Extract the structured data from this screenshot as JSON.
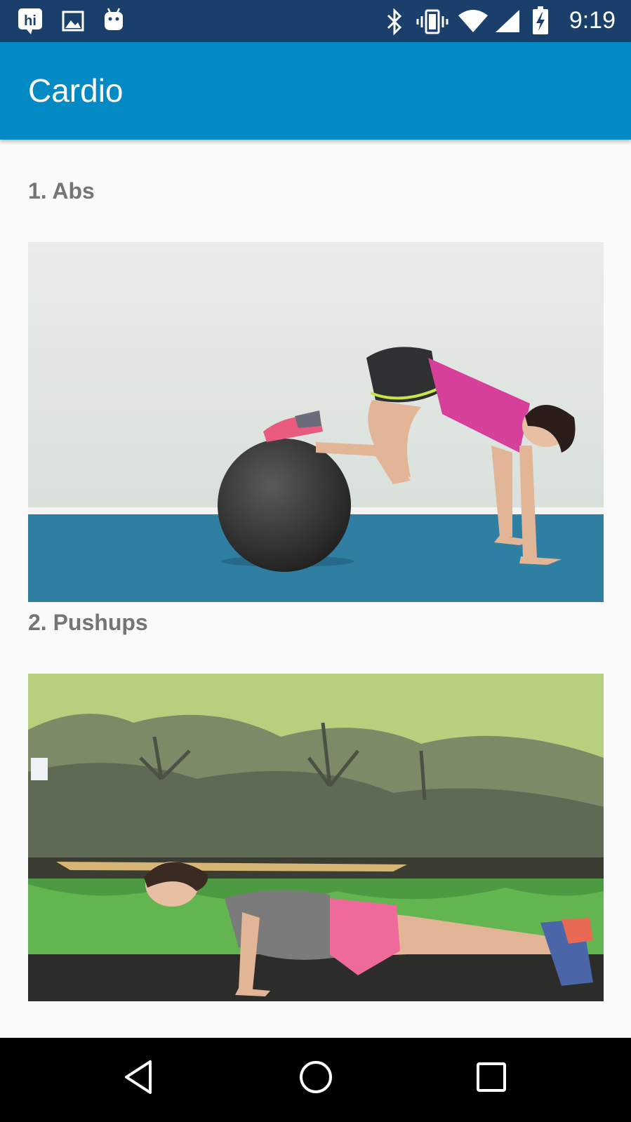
{
  "status_bar": {
    "time": "9:19",
    "left_icons": [
      "hi-app-icon",
      "image-icon",
      "android-icon"
    ],
    "right_icons": [
      "bluetooth-icon",
      "vibrate-icon",
      "wifi-icon",
      "signal-icon",
      "battery-charging-icon"
    ]
  },
  "app_bar": {
    "title": "Cardio"
  },
  "exercises": [
    {
      "title": "1. Abs",
      "image_alt": "stability-ball-knee-tuck"
    },
    {
      "title": "2. Pushups",
      "image_alt": "pushup"
    }
  ],
  "nav_bar": {
    "buttons": [
      "back-icon",
      "home-icon",
      "recents-icon"
    ]
  },
  "colors": {
    "status_bar": "#1a3f6b",
    "app_bar": "#0389c4",
    "background": "#fafafa",
    "title_text": "#757575"
  }
}
